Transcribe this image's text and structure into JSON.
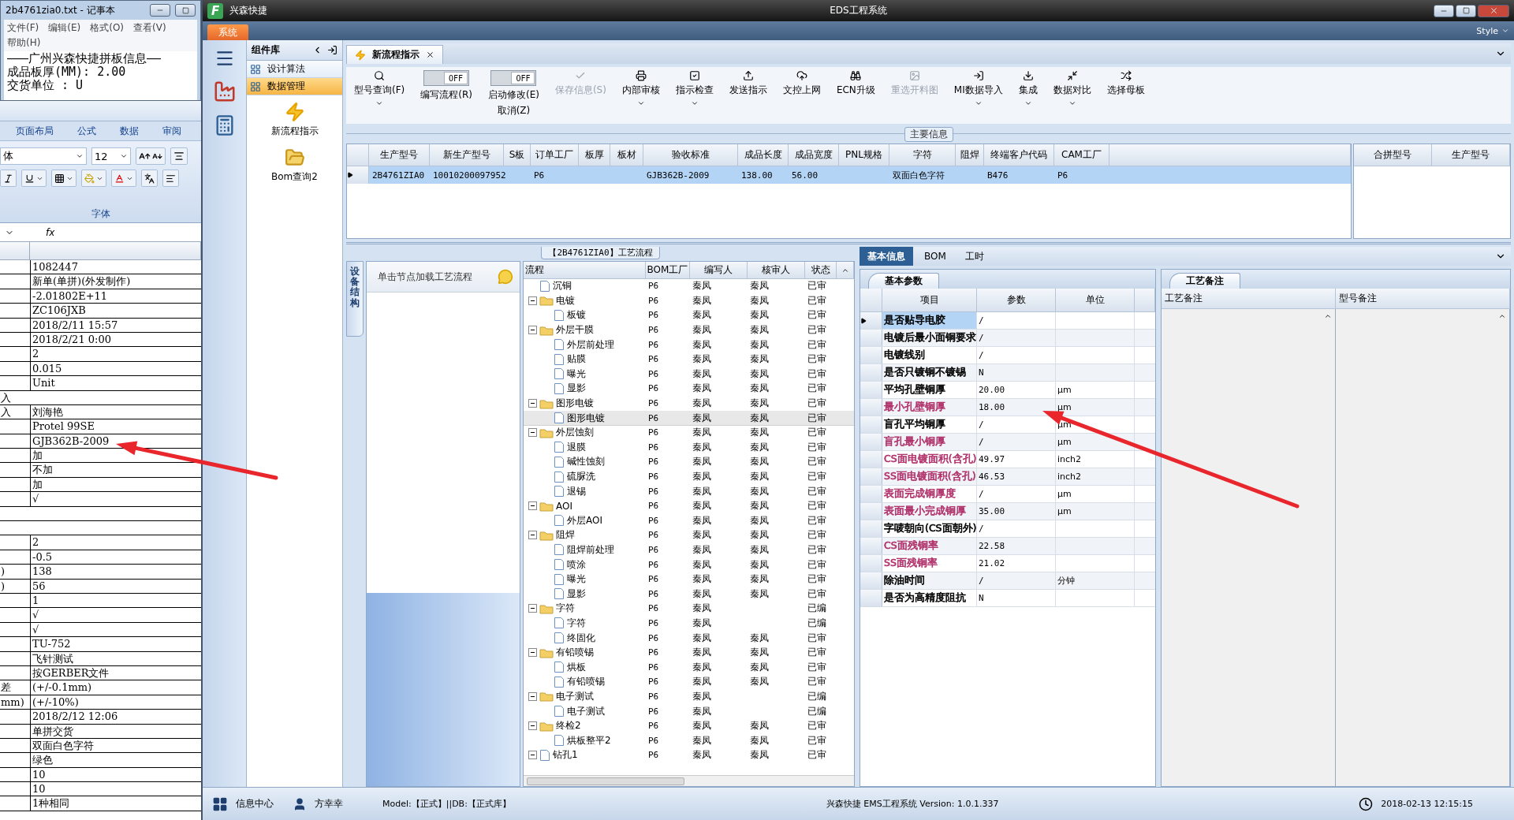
{
  "notepad": {
    "title": "2b4761zia0.txt - 记事本",
    "menu": [
      "文件(F)",
      "编辑(E)",
      "格式(O)",
      "查看(V)",
      "帮助(H)"
    ],
    "lines": [
      "———广州兴森快捷拼板信息——",
      "成品板厚(MM): 2.00",
      "交货单位 : U"
    ]
  },
  "spreadsheet": {
    "ribbon_tabs": [
      "页面布局",
      "公式",
      "数据",
      "审阅"
    ],
    "font_name": "体",
    "font_size": "12",
    "group_label": "字体",
    "formula_label": "fx",
    "rows": [
      {
        "b": "1082447"
      },
      {
        "b": "新单(单拼)(外发制作)"
      },
      {
        "b": "-2.01802E+11"
      },
      {
        "b": "ZC106JXB"
      },
      {
        "b": "2018/2/11 15:57"
      },
      {
        "b": "2018/2/21 0:00"
      },
      {
        "b": "2"
      },
      {
        "b": "0.015"
      },
      {
        "b": "Unit"
      },
      {
        "a": "入",
        "merged": true
      },
      {
        "a": "入",
        "b": "刘海艳"
      },
      {
        "b": "Protel 99SE"
      },
      {
        "b": "GJB362B-2009"
      },
      {
        "b": "加"
      },
      {
        "b": "不加"
      },
      {
        "b": "加"
      },
      {
        "b": "√"
      },
      {
        "merged": true
      },
      {
        "merged": true
      },
      {
        "b": "2"
      },
      {
        "b": "-0.5"
      },
      {
        "a": ")",
        "b": "138"
      },
      {
        "a": ")",
        "b": "56"
      },
      {
        "b": "1"
      },
      {
        "b": "√"
      },
      {
        "b": "√"
      },
      {
        "b": "TU-752"
      },
      {
        "b": "飞针测试"
      },
      {
        "b": "按GERBER文件"
      },
      {
        "a": "差",
        "b": "(+/-0.1mm)"
      },
      {
        "a": "mm)",
        "b": "(+/-10%)"
      },
      {
        "b": "2018/2/12 12:06"
      },
      {
        "b": "单拼交货"
      },
      {
        "b": "双面白色字符"
      },
      {
        "b": "绿色"
      },
      {
        "b": "10"
      },
      {
        "b": "10"
      },
      {
        "b": "1种相同"
      }
    ]
  },
  "app": {
    "logo_letter": "F",
    "brand": "兴森快捷",
    "title": "EDS工程系统",
    "menu_tab": "系统",
    "style_label": "Style",
    "component_panel": {
      "title": "组件库",
      "items": [
        {
          "label": "设计算法",
          "selected": false
        },
        {
          "label": "数据管理",
          "selected": true
        }
      ],
      "tools": [
        "新流程指示",
        "Bom查询2"
      ]
    },
    "document_tab": {
      "label": "新流程指示"
    },
    "toolbar": [
      {
        "kind": "button",
        "label": "型号查询(F)",
        "dropdown": true,
        "disabled": false
      },
      {
        "kind": "toggle",
        "label": "编写流程(R)",
        "on": false,
        "state_label": "OFF"
      },
      {
        "kind": "toggle",
        "label": "启动修改(E)",
        "sub_label": "取消(Z)",
        "on": false,
        "state_label": "OFF"
      },
      {
        "kind": "button",
        "label": "保存信息(S)",
        "dropdown": false,
        "disabled": true
      },
      {
        "kind": "button",
        "label": "内部审核",
        "dropdown": true,
        "disabled": false
      },
      {
        "kind": "button",
        "label": "指示检查",
        "dropdown": true,
        "disabled": false
      },
      {
        "kind": "button",
        "label": "发送指示",
        "dropdown": false,
        "disabled": false
      },
      {
        "kind": "button",
        "label": "文控上网",
        "dropdown": false,
        "disabled": false
      },
      {
        "kind": "button",
        "label": "ECN升级",
        "dropdown": false,
        "disabled": false
      },
      {
        "kind": "button",
        "label": "重选开料图",
        "dropdown": false,
        "disabled": true
      },
      {
        "kind": "button",
        "label": "MI数据导入",
        "dropdown": true,
        "disabled": false
      },
      {
        "kind": "button",
        "label": "集成",
        "dropdown": true,
        "disabled": false
      },
      {
        "kind": "button",
        "label": "数据对比",
        "dropdown": true,
        "disabled": false
      },
      {
        "kind": "button",
        "label": "选择母板",
        "dropdown": false,
        "disabled": false
      }
    ],
    "main_info": {
      "legend": "主要信息",
      "columns": [
        "生产型号",
        "新生产型号",
        "S板",
        "订单工厂",
        "板厚",
        "板材",
        "验收标准",
        "成品长度",
        "成品宽度",
        "PNL规格",
        "字符",
        "阻焊",
        "终端客户代码",
        "CAM工厂"
      ],
      "rows": [
        {
          "selected": true,
          "cells": [
            "2B4761ZIA0",
            "10010200097952",
            null,
            "P6",
            null,
            null,
            "GJB362B-2009",
            "138.00",
            "56.00",
            null,
            "双面白色字符",
            null,
            "B476",
            "P6"
          ]
        }
      ],
      "side_columns": [
        "合拼型号",
        "生产型号"
      ]
    },
    "process": {
      "side_tab": "设备结构",
      "hint": "单击节点加载工艺流程",
      "title": "【2B4761ZIA0】工艺流程",
      "columns": [
        "流程",
        "BOM工厂",
        "编写人",
        "核审人",
        "状态"
      ],
      "tree": [
        {
          "label": "沉铜",
          "bom": "P6",
          "writer": "秦凤",
          "reviewer": "秦凤",
          "status": "已审",
          "selected": false
        },
        {
          "label": "电镀",
          "bom": "P6",
          "writer": "秦凤",
          "reviewer": "秦凤",
          "status": "已审",
          "selected": false,
          "expanded": true,
          "children": [
            {
              "label": "板镀",
              "bom": "P6",
              "writer": "秦凤",
              "reviewer": "秦凤",
              "status": "已审",
              "selected": false
            }
          ]
        },
        {
          "label": "外层干膜",
          "bom": "P6",
          "writer": "秦凤",
          "reviewer": "秦凤",
          "status": "已审",
          "selected": false,
          "expanded": true,
          "children": [
            {
              "label": "外层前处理",
              "bom": "P6",
              "writer": "秦凤",
              "reviewer": "秦凤",
              "status": "已审",
              "selected": false
            },
            {
              "label": "贴膜",
              "bom": "P6",
              "writer": "秦凤",
              "reviewer": "秦凤",
              "status": "已审",
              "selected": false
            },
            {
              "label": "曝光",
              "bom": "P6",
              "writer": "秦凤",
              "reviewer": "秦凤",
              "status": "已审",
              "selected": false
            },
            {
              "label": "显影",
              "bom": "P6",
              "writer": "秦凤",
              "reviewer": "秦凤",
              "status": "已审",
              "selected": false
            }
          ]
        },
        {
          "label": "图形电镀",
          "bom": "P6",
          "writer": "秦凤",
          "reviewer": "秦凤",
          "status": "已审",
          "selected": false,
          "expanded": true,
          "children": [
            {
              "label": "图形电镀",
              "bom": "P6",
              "writer": "秦凤",
              "reviewer": "秦凤",
              "status": "已审",
              "selected": true
            }
          ]
        },
        {
          "label": "外层蚀刻",
          "bom": "P6",
          "writer": "秦凤",
          "reviewer": "秦凤",
          "status": "已审",
          "selected": false,
          "expanded": true,
          "children": [
            {
              "label": "退膜",
              "bom": "P6",
              "writer": "秦凤",
              "reviewer": "秦凤",
              "status": "已审",
              "selected": false
            },
            {
              "label": "碱性蚀刻",
              "bom": "P6",
              "writer": "秦凤",
              "reviewer": "秦凤",
              "status": "已审",
              "selected": false
            },
            {
              "label": "硫脲洗",
              "bom": "P6",
              "writer": "秦凤",
              "reviewer": "秦凤",
              "status": "已审",
              "selected": false
            },
            {
              "label": "退锡",
              "bom": "P6",
              "writer": "秦凤",
              "reviewer": "秦凤",
              "status": "已审",
              "selected": false
            }
          ]
        },
        {
          "label": "AOI",
          "bom": "P6",
          "writer": "秦凤",
          "reviewer": "秦凤",
          "status": "已审",
          "selected": false,
          "expanded": true,
          "children": [
            {
              "label": "外层AOI",
              "bom": "P6",
              "writer": "秦凤",
              "reviewer": "秦凤",
              "status": "已审",
              "selected": false
            }
          ]
        },
        {
          "label": "阻焊",
          "bom": "P6",
          "writer": "秦凤",
          "reviewer": "秦凤",
          "status": "已审",
          "selected": false,
          "expanded": true,
          "children": [
            {
              "label": "阻焊前处理",
              "bom": "P6",
              "writer": "秦凤",
              "reviewer": "秦凤",
              "status": "已审",
              "selected": false
            },
            {
              "label": "喷涂",
              "bom": "P6",
              "writer": "秦凤",
              "reviewer": "秦凤",
              "status": "已审",
              "selected": false
            },
            {
              "label": "曝光",
              "bom": "P6",
              "writer": "秦凤",
              "reviewer": "秦凤",
              "status": "已审",
              "selected": false
            },
            {
              "label": "显影",
              "bom": "P6",
              "writer": "秦凤",
              "reviewer": "秦凤",
              "status": "已审",
              "selected": false
            }
          ]
        },
        {
          "label": "字符",
          "bom": "P6",
          "writer": "秦凤",
          "status": "已编",
          "selected": false,
          "expanded": true,
          "children": [
            {
              "label": "字符",
              "bom": "P6",
              "writer": "秦凤",
              "status": "已编",
              "selected": false
            },
            {
              "label": "终固化",
              "bom": "P6",
              "writer": "秦凤",
              "reviewer": "秦凤",
              "status": "已审",
              "selected": false
            }
          ]
        },
        {
          "label": "有铅喷锡",
          "bom": "P6",
          "writer": "秦凤",
          "reviewer": "秦凤",
          "status": "已审",
          "selected": false,
          "expanded": true,
          "children": [
            {
              "label": "烘板",
              "bom": "P6",
              "writer": "秦凤",
              "reviewer": "秦凤",
              "status": "已审",
              "selected": false
            },
            {
              "label": "有铅喷锡",
              "bom": "P6",
              "writer": "秦凤",
              "reviewer": "秦凤",
              "status": "已审",
              "selected": false
            }
          ]
        },
        {
          "label": "电子测试",
          "bom": "P6",
          "writer": "秦凤",
          "status": "已编",
          "selected": false,
          "expanded": true,
          "children": [
            {
              "label": "电子测试",
              "bom": "P6",
              "writer": "秦凤",
              "status": "已编",
              "selected": false
            }
          ]
        },
        {
          "label": "终检2",
          "bom": "P6",
          "writer": "秦凤",
          "reviewer": "秦凤",
          "status": "已审",
          "selected": false,
          "expanded": true,
          "children": [
            {
              "label": "烘板整平2",
              "bom": "P6",
              "writer": "秦凤",
              "reviewer": "秦凤",
              "status": "已审",
              "selected": false
            }
          ]
        },
        {
          "label": "钻孔1",
          "bom": "P6",
          "writer": "秦凤",
          "reviewer": "秦凤",
          "status": "已审",
          "selected": false,
          "expanded": true
        }
      ]
    },
    "detail": {
      "tabs": [
        {
          "label": "基本信息",
          "selected": true
        },
        {
          "label": "BOM",
          "selected": false
        },
        {
          "label": "工时",
          "selected": false
        }
      ],
      "params": {
        "title": "基本参数",
        "columns": [
          "项目",
          "参数",
          "单位"
        ],
        "rows": [
          {
            "name": "是否贴导电胶",
            "value": "/",
            "selected": true,
            "color": "#000000"
          },
          {
            "name": "电镀后最小面铜要求",
            "value": "/",
            "selected": false,
            "color": "#000000"
          },
          {
            "name": "电镀线别",
            "value": "/",
            "selected": false,
            "color": "#000000"
          },
          {
            "name": "是否只镀铜不镀锡",
            "value": "N",
            "selected": false,
            "color": "#000000"
          },
          {
            "name": "平均孔壁铜厚",
            "value": "20.00",
            "unit": "µm",
            "selected": false,
            "color": "#000000"
          },
          {
            "name": "最小孔壁铜厚",
            "value": "18.00",
            "unit": "µm",
            "selected": false,
            "color": "#b0306a"
          },
          {
            "name": "盲孔平均铜厚",
            "value": "/",
            "unit": "µm",
            "selected": false,
            "color": "#000000"
          },
          {
            "name": "盲孔最小铜厚",
            "value": "/",
            "unit": "µm",
            "selected": false,
            "color": "#b0306a"
          },
          {
            "name": "CS面电镀面积(含孔)",
            "value": "49.97",
            "unit": "inch2",
            "selected": false,
            "color": "#b0306a"
          },
          {
            "name": "SS面电镀面积(含孔)",
            "value": "46.53",
            "unit": "inch2",
            "selected": false,
            "color": "#b0306a"
          },
          {
            "name": "表面完成铜厚度",
            "value": "/",
            "unit": "µm",
            "selected": false,
            "color": "#b0306a"
          },
          {
            "name": "表面最小完成铜厚",
            "value": "35.00",
            "unit": "µm",
            "selected": false,
            "color": "#b0306a"
          },
          {
            "name": "字唛朝向(CS面朝外)",
            "value": "/",
            "selected": false,
            "color": "#000000"
          },
          {
            "name": "CS面残铜率",
            "value": "22.58",
            "selected": false,
            "color": "#b0306a"
          },
          {
            "name": "SS面残铜率",
            "value": "21.02",
            "selected": false,
            "color": "#b0306a"
          },
          {
            "name": "除油时间",
            "value": "/",
            "unit": "分钟",
            "selected": false,
            "color": "#000000"
          },
          {
            "name": "是否为高精度阻抗",
            "value": "N",
            "selected": false,
            "color": "#000000"
          }
        ]
      },
      "notes": {
        "title": "工艺备注",
        "columns": [
          "工艺备注",
          "型号备注"
        ]
      }
    },
    "status_bar": {
      "info_center": "信息中心",
      "user": "方幸幸",
      "model": "Model:【正式】||DB:【正式库】",
      "version": "兴森快捷 EMS工程系统 Version: 1.0.1.337",
      "time": "2018-02-13 12:15:15"
    }
  }
}
